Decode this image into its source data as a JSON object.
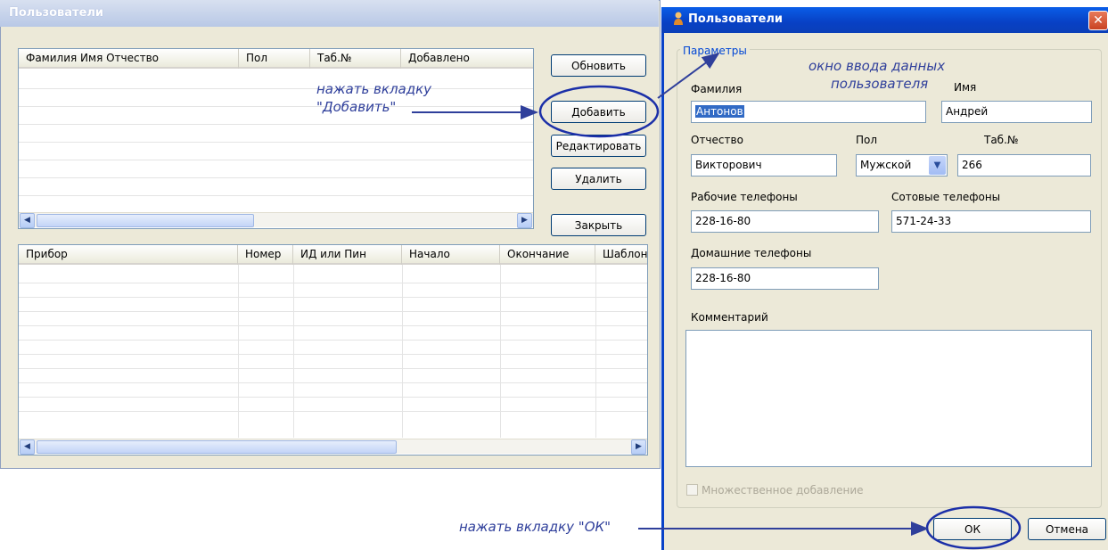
{
  "left_window": {
    "title": "Пользователи",
    "users_table": {
      "columns": [
        "Фамилия Имя Отчество",
        "Пол",
        "Таб.№",
        "Добавлено"
      ]
    },
    "devices_table": {
      "columns": [
        "Прибор",
        "Номер",
        "ИД или Пин",
        "Начало",
        "Окончание",
        "Шаблон"
      ]
    },
    "buttons": {
      "refresh": "Обновить",
      "add": "Добавить",
      "edit": "Редактировать",
      "delete": "Удалить",
      "close": "Закрыть"
    }
  },
  "dialog": {
    "title": "Пользователи",
    "close_glyph": "✕",
    "group_label": "Параметры",
    "fields": {
      "surname_label": "Фамилия",
      "surname_value": "Антонов",
      "name_label": "Имя",
      "name_value": "Андрей",
      "patronymic_label": "Отчество",
      "patronymic_value": "Викторович",
      "gender_label": "Пол",
      "gender_value": "Мужской",
      "tab_label": "Таб.№",
      "tab_value": "266",
      "work_phones_label": "Рабочие телефоны",
      "work_phones_value": "228-16-80",
      "mobile_phones_label": "Сотовые телефоны",
      "mobile_phones_value": "571-24-33",
      "home_phones_label": "Домашние телефоны",
      "home_phones_value": "228-16-80",
      "comment_label": "Комментарий",
      "multi_add_label": "Множественное добавление"
    },
    "buttons": {
      "ok": "ОК",
      "cancel": "Отмена"
    }
  },
  "annotations": {
    "press_add_line1": "нажать вкладку",
    "press_add_line2": "\"Добавить\"",
    "input_window_line1": "окно ввода  данных",
    "input_window_line2": "пользователя",
    "press_ok": "нажать вкладку \"ОК\""
  },
  "colors": {
    "annotation": "#2f3f9b",
    "dialog_title_bar": "#0842c8",
    "selection": "#316ac5",
    "group_label": "#0046d5"
  }
}
